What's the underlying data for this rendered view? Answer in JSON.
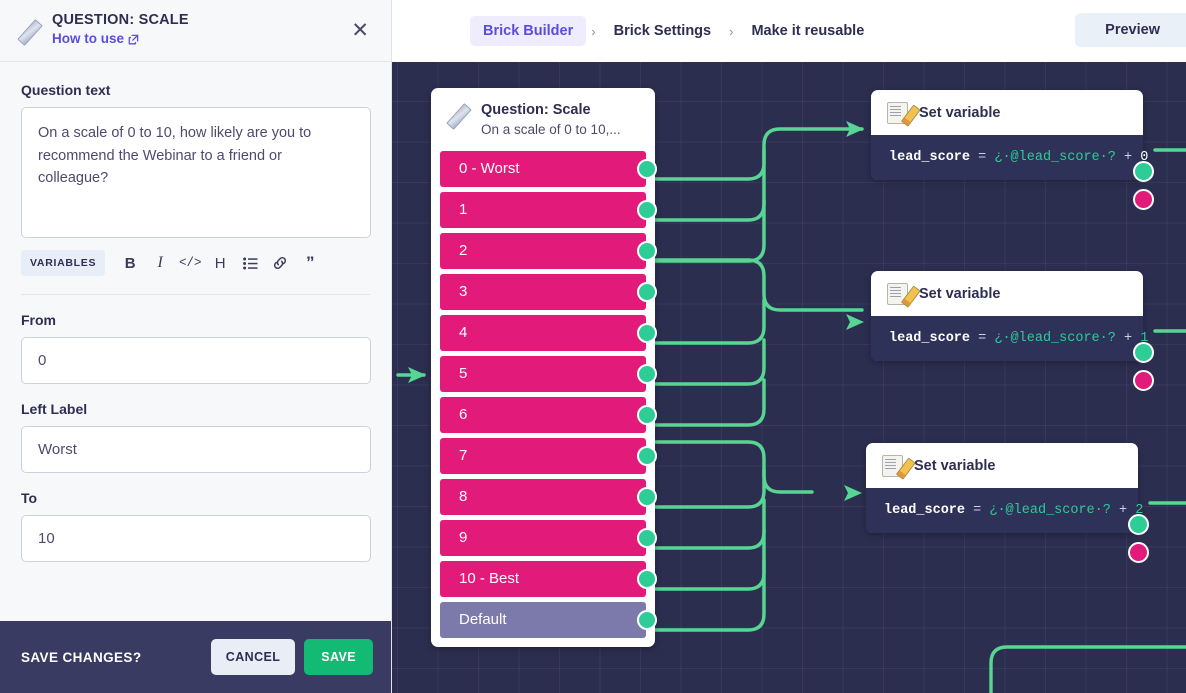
{
  "panel": {
    "icon": "ruler-icon",
    "title": "QUESTION: SCALE",
    "how_to_use": "How to use",
    "external_link_icon": "external-link-icon",
    "close_icon": "✕",
    "question_text_label": "Question text",
    "question_text_value": "On a scale of 0 to 10, how likely are you to recommend the Webinar to a friend or colleague?",
    "toolbar": {
      "variables_label": "VARIABLES",
      "bold_label": "B",
      "italic_label": "I",
      "code_label": "</>",
      "heading_label": "H",
      "list_label": "☰",
      "link_label": "🔗",
      "quote_label": "”"
    },
    "from_label": "From",
    "from_value": "0",
    "left_label_label": "Left Label",
    "left_label_value": "Worst",
    "to_label": "To",
    "to_value": "10",
    "save_bar": {
      "prompt": "SAVE CHANGES?",
      "cancel_label": "CANCEL",
      "save_label": "SAVE",
      "save_color": "#12ba74"
    }
  },
  "topbar": {
    "breadcrumb": [
      {
        "label": "Brick Builder",
        "active": true
      },
      {
        "label": "Brick Settings",
        "active": false
      },
      {
        "label": "Make it reusable",
        "active": false
      }
    ],
    "separator": "›",
    "preview_label": "Preview"
  },
  "canvas": {
    "question_node": {
      "icon": "ruler-icon",
      "title": "Question: Scale",
      "subtitle": "On a scale of 0 to 10,...",
      "options": [
        {
          "label": "0 - Worst",
          "kind": "scale"
        },
        {
          "label": "1",
          "kind": "scale"
        },
        {
          "label": "2",
          "kind": "scale"
        },
        {
          "label": "3",
          "kind": "scale"
        },
        {
          "label": "4",
          "kind": "scale"
        },
        {
          "label": "5",
          "kind": "scale"
        },
        {
          "label": "6",
          "kind": "scale"
        },
        {
          "label": "7",
          "kind": "scale"
        },
        {
          "label": "8",
          "kind": "scale"
        },
        {
          "label": "9",
          "kind": "scale"
        },
        {
          "label": "10 - Best",
          "kind": "scale"
        },
        {
          "label": "Default",
          "kind": "default"
        }
      ],
      "option_color": "#e21b7a",
      "default_color": "#7b7aab",
      "port_color": "#2ecc96"
    },
    "set_variable_nodes": [
      {
        "icon": "memo-pencil-icon",
        "title": "Set variable",
        "variable": "lead_score",
        "equals": "=",
        "expression": "¿·@lead_score·?",
        "plus": "+",
        "amount": "0",
        "amount_green": false
      },
      {
        "icon": "memo-pencil-icon",
        "title": "Set variable",
        "variable": "lead_score",
        "equals": "=",
        "expression": "¿·@lead_score·?",
        "plus": "+",
        "amount": "1",
        "amount_green": true
      },
      {
        "icon": "memo-pencil-icon",
        "title": "Set variable",
        "variable": "lead_score",
        "equals": "=",
        "expression": "¿·@lead_score·?",
        "plus": "+",
        "amount": "2",
        "amount_green": true
      }
    ],
    "edge_color": "#57d693",
    "background_color": "#2c2e50"
  }
}
